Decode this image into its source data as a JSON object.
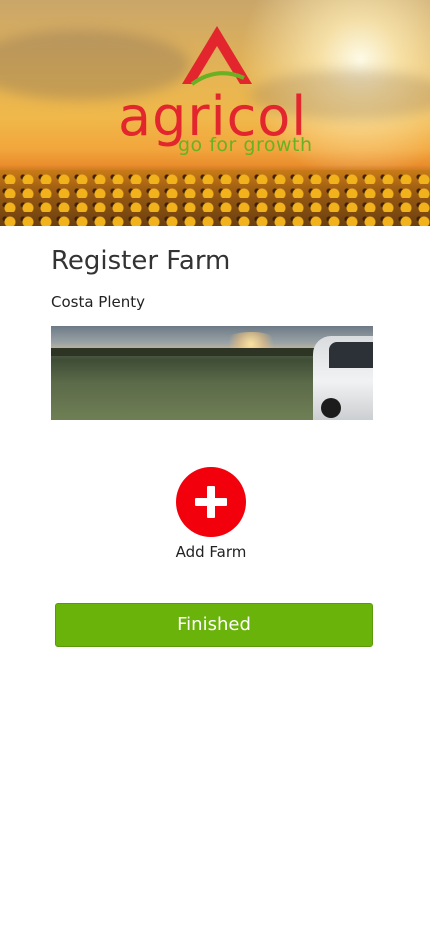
{
  "header": {
    "logo_text": "agricol",
    "logo_tagline": "go for growth",
    "brand_color": "#e3262e",
    "tagline_color": "#6ab023",
    "logo_mark_icon": "agricol-logo-mark-icon"
  },
  "main": {
    "title": "Register Farm",
    "farm_name": "Costa Plenty",
    "add_farm": {
      "label": "Add Farm",
      "icon": "plus-icon",
      "color": "#f2000c"
    },
    "finished_button": {
      "label": "Finished",
      "color": "#69b30b"
    }
  }
}
